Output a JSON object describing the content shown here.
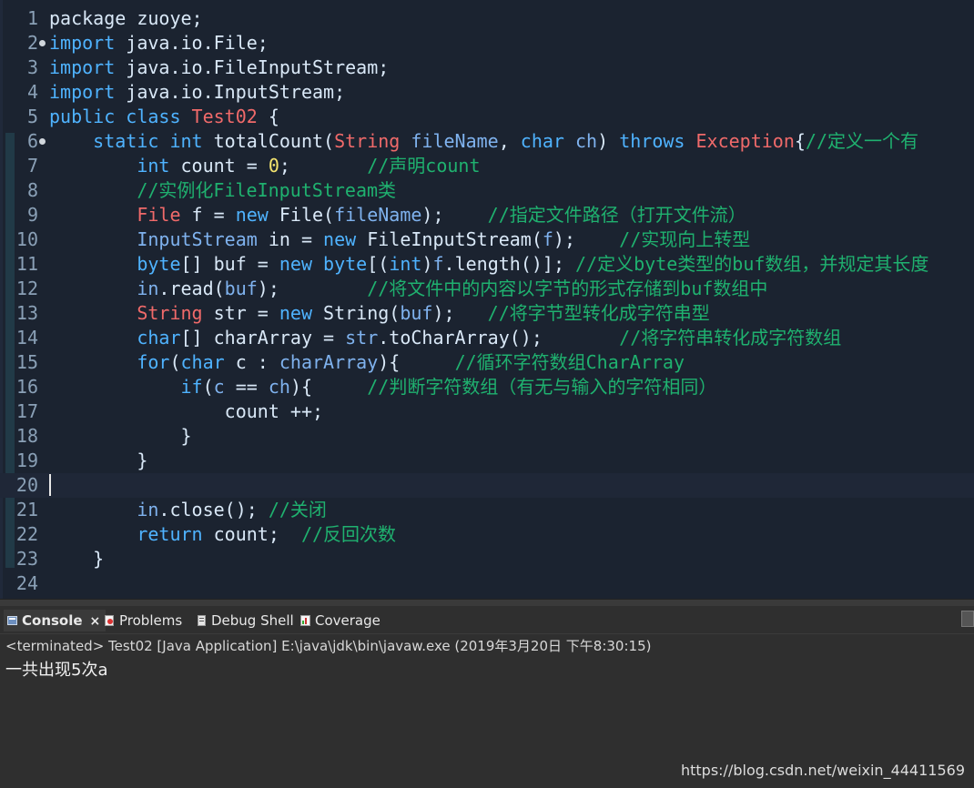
{
  "editor": {
    "lines": [
      {
        "n": "1",
        "tokens": [
          {
            "t": "package zuoye;",
            "c": "plain"
          }
        ]
      },
      {
        "n": "2",
        "tokens": [
          {
            "t": "import",
            "c": "kw"
          },
          {
            "t": " java.io.File;",
            "c": "plain"
          }
        ]
      },
      {
        "n": "3",
        "tokens": [
          {
            "t": "import",
            "c": "kw"
          },
          {
            "t": " java.io.FileInputStream;",
            "c": "plain"
          }
        ]
      },
      {
        "n": "4",
        "tokens": [
          {
            "t": "import",
            "c": "kw"
          },
          {
            "t": " java.io.InputStream;",
            "c": "plain"
          }
        ]
      },
      {
        "n": "5",
        "tokens": [
          {
            "t": "public class ",
            "c": "kw"
          },
          {
            "t": "Test02",
            "c": "ty"
          },
          {
            "t": " {",
            "c": "plain"
          }
        ]
      },
      {
        "n": "6",
        "tokens": [
          {
            "t": "    static int ",
            "c": "kw"
          },
          {
            "t": "totalCount(",
            "c": "plain"
          },
          {
            "t": "String",
            "c": "ty"
          },
          {
            "t": " ",
            "c": "plain"
          },
          {
            "t": "fileName",
            "c": "var"
          },
          {
            "t": ", ",
            "c": "plain"
          },
          {
            "t": "char",
            "c": "kw"
          },
          {
            "t": " ",
            "c": "plain"
          },
          {
            "t": "ch",
            "c": "var"
          },
          {
            "t": ") ",
            "c": "plain"
          },
          {
            "t": "throws",
            "c": "kw"
          },
          {
            "t": " ",
            "c": "plain"
          },
          {
            "t": "Exception",
            "c": "ty"
          },
          {
            "t": "{",
            "c": "plain"
          },
          {
            "t": "//定义一个有",
            "c": "cm"
          }
        ]
      },
      {
        "n": "7",
        "tokens": [
          {
            "t": "        int",
            "c": "kw"
          },
          {
            "t": " count = ",
            "c": "plain"
          },
          {
            "t": "0",
            "c": "num"
          },
          {
            "t": ";       ",
            "c": "plain"
          },
          {
            "t": "//声明count",
            "c": "cm"
          }
        ]
      },
      {
        "n": "8",
        "tokens": [
          {
            "t": "        //实例化FileInputStream类",
            "c": "cm"
          }
        ]
      },
      {
        "n": "9",
        "tokens": [
          {
            "t": "        File",
            "c": "ty"
          },
          {
            "t": " f = ",
            "c": "plain"
          },
          {
            "t": "new",
            "c": "kw"
          },
          {
            "t": " File(",
            "c": "plain"
          },
          {
            "t": "fileName",
            "c": "var"
          },
          {
            "t": ");    ",
            "c": "plain"
          },
          {
            "t": "//指定文件路径（打开文件流）",
            "c": "cm"
          }
        ]
      },
      {
        "n": "10",
        "tokens": [
          {
            "t": "        InputStream",
            "c": "var"
          },
          {
            "t": " in = ",
            "c": "plain"
          },
          {
            "t": "new",
            "c": "kw"
          },
          {
            "t": " FileInputStream(",
            "c": "plain"
          },
          {
            "t": "f",
            "c": "var"
          },
          {
            "t": ");    ",
            "c": "plain"
          },
          {
            "t": "//实现向上转型",
            "c": "cm"
          }
        ]
      },
      {
        "n": "11",
        "tokens": [
          {
            "t": "        byte",
            "c": "kw"
          },
          {
            "t": "[] buf = ",
            "c": "plain"
          },
          {
            "t": "new",
            "c": "kw"
          },
          {
            "t": " ",
            "c": "plain"
          },
          {
            "t": "byte",
            "c": "kw"
          },
          {
            "t": "[(",
            "c": "plain"
          },
          {
            "t": "int",
            "c": "kw"
          },
          {
            "t": ")",
            "c": "plain"
          },
          {
            "t": "f",
            "c": "var"
          },
          {
            "t": ".length()]; ",
            "c": "plain"
          },
          {
            "t": "//定义byte类型的buf数组，并规定其长度",
            "c": "cm"
          }
        ]
      },
      {
        "n": "12",
        "tokens": [
          {
            "t": "        in",
            "c": "var"
          },
          {
            "t": ".read(",
            "c": "plain"
          },
          {
            "t": "buf",
            "c": "var"
          },
          {
            "t": ");        ",
            "c": "plain"
          },
          {
            "t": "//将文件中的内容以字节的形式存储到buf数组中",
            "c": "cm"
          }
        ]
      },
      {
        "n": "13",
        "tokens": [
          {
            "t": "        String",
            "c": "ty"
          },
          {
            "t": " str = ",
            "c": "plain"
          },
          {
            "t": "new",
            "c": "kw"
          },
          {
            "t": " String(",
            "c": "plain"
          },
          {
            "t": "buf",
            "c": "var"
          },
          {
            "t": ");   ",
            "c": "plain"
          },
          {
            "t": "//将字节型转化成字符串型",
            "c": "cm"
          }
        ]
      },
      {
        "n": "14",
        "tokens": [
          {
            "t": "        char",
            "c": "kw"
          },
          {
            "t": "[] charArray = ",
            "c": "plain"
          },
          {
            "t": "str",
            "c": "var"
          },
          {
            "t": ".toCharArray();       ",
            "c": "plain"
          },
          {
            "t": "//将字符串转化成字符数组",
            "c": "cm"
          }
        ]
      },
      {
        "n": "15",
        "tokens": [
          {
            "t": "        for",
            "c": "kw"
          },
          {
            "t": "(",
            "c": "plain"
          },
          {
            "t": "char",
            "c": "kw"
          },
          {
            "t": " c : ",
            "c": "plain"
          },
          {
            "t": "charArray",
            "c": "var"
          },
          {
            "t": "){     ",
            "c": "plain"
          },
          {
            "t": "//循环字符数组CharArray",
            "c": "cm"
          }
        ]
      },
      {
        "n": "16",
        "tokens": [
          {
            "t": "            if",
            "c": "kw"
          },
          {
            "t": "(",
            "c": "plain"
          },
          {
            "t": "c",
            "c": "var"
          },
          {
            "t": " == ",
            "c": "plain"
          },
          {
            "t": "ch",
            "c": "var"
          },
          {
            "t": "){     ",
            "c": "plain"
          },
          {
            "t": "//判断字符数组（有无与输入的字符相同）",
            "c": "cm"
          }
        ]
      },
      {
        "n": "17",
        "tokens": [
          {
            "t": "                count ++;",
            "c": "plain"
          }
        ]
      },
      {
        "n": "18",
        "tokens": [
          {
            "t": "            }",
            "c": "plain"
          }
        ]
      },
      {
        "n": "19",
        "tokens": [
          {
            "t": "        }",
            "c": "plain"
          }
        ]
      },
      {
        "n": "20",
        "tokens": []
      },
      {
        "n": "21",
        "tokens": [
          {
            "t": "        in",
            "c": "var"
          },
          {
            "t": ".close(); ",
            "c": "plain"
          },
          {
            "t": "//关闭",
            "c": "cm"
          }
        ]
      },
      {
        "n": "22",
        "tokens": [
          {
            "t": "        return",
            "c": "kw"
          },
          {
            "t": " count;  ",
            "c": "plain"
          },
          {
            "t": "//反回次数",
            "c": "cm"
          }
        ]
      },
      {
        "n": "23",
        "tokens": [
          {
            "t": "    }",
            "c": "plain"
          }
        ]
      },
      {
        "n": "24",
        "tokens": []
      }
    ]
  },
  "console": {
    "tabs": [
      {
        "label": "Console",
        "active": true,
        "icon": "console-icon",
        "close": "×"
      },
      {
        "label": "Problems",
        "active": false,
        "icon": "problems-icon"
      },
      {
        "label": "Debug Shell",
        "active": false,
        "icon": "debug-shell-icon"
      },
      {
        "label": "Coverage",
        "active": false,
        "icon": "coverage-icon"
      }
    ],
    "status": "<terminated> Test02 [Java Application] E:\\java\\jdk\\bin\\javaw.exe (2019年3月20日 下午8:30:15)",
    "output": "一共出现5次a"
  },
  "watermark": "https://blog.csdn.net/weixin_44411569",
  "colors": {
    "editor_bg": "#1b2330",
    "keyword": "#4fb3ff",
    "type": "#f06a6a",
    "comment": "#1fb16f",
    "number": "#f4e46f"
  }
}
